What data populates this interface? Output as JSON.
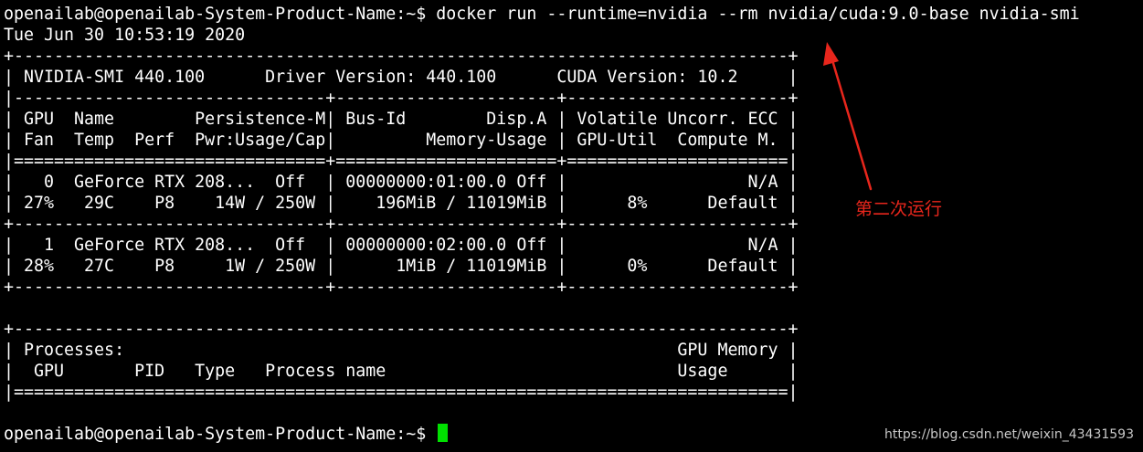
{
  "terminal": {
    "lines": [
      "openailab@openailab-System-Product-Name:~$ docker run --runtime=nvidia --rm nvidia/cuda:9.0-base nvidia-smi",
      "Tue Jun 30 10:53:19 2020",
      "+-----------------------------------------------------------------------------+",
      "| NVIDIA-SMI 440.100      Driver Version: 440.100      CUDA Version: 10.2     |",
      "|-------------------------------+----------------------+----------------------+",
      "| GPU  Name        Persistence-M| Bus-Id        Disp.A | Volatile Uncorr. ECC |",
      "| Fan  Temp  Perf  Pwr:Usage/Cap|         Memory-Usage | GPU-Util  Compute M. |",
      "|===============================+======================+======================|",
      "|   0  GeForce RTX 208...  Off  | 00000000:01:00.0 Off |                  N/A |",
      "| 27%   29C    P8    14W / 250W |    196MiB / 11019MiB |      8%      Default |",
      "+-------------------------------+----------------------+----------------------+",
      "|   1  GeForce RTX 208...  Off  | 00000000:02:00.0 Off |                  N/A |",
      "| 28%   27C    P8     1W / 250W |      1MiB / 11019MiB |      0%      Default |",
      "+-------------------------------+----------------------+----------------------+",
      "",
      "+-----------------------------------------------------------------------------+",
      "| Processes:                                                       GPU Memory |",
      "|  GPU       PID   Type   Process name                             Usage      |",
      "|=============================================================================|",
      ""
    ],
    "prompt": "openailab@openailab-System-Product-Name:~$ "
  },
  "annotation": {
    "text": "第二次运行"
  },
  "watermark": {
    "text": "https://blog.csdn.net/weixin_43431593"
  },
  "colors": {
    "background": "#000000",
    "text": "#ffffff",
    "cursor": "#00e000",
    "annotation": "#e8261c"
  }
}
